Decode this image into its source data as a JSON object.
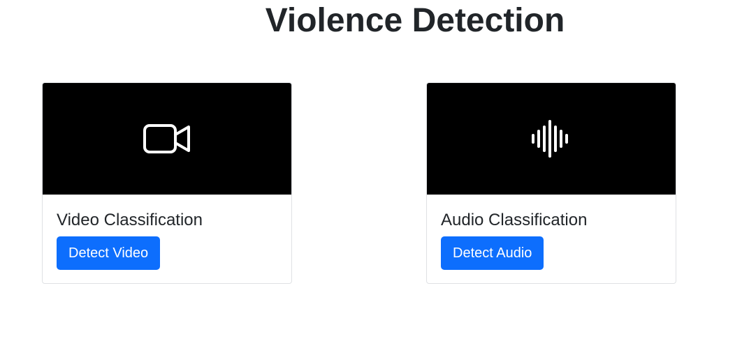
{
  "header": {
    "title": "Violence Detection"
  },
  "cards": [
    {
      "icon": "video-camera-icon",
      "title": "Video Classification",
      "button_label": "Detect Video"
    },
    {
      "icon": "sound-wave-icon",
      "title": "Audio Classification",
      "button_label": "Detect Audio"
    }
  ],
  "colors": {
    "primary_button": "#0d6efd",
    "media_background": "#000000",
    "text": "#212529"
  }
}
